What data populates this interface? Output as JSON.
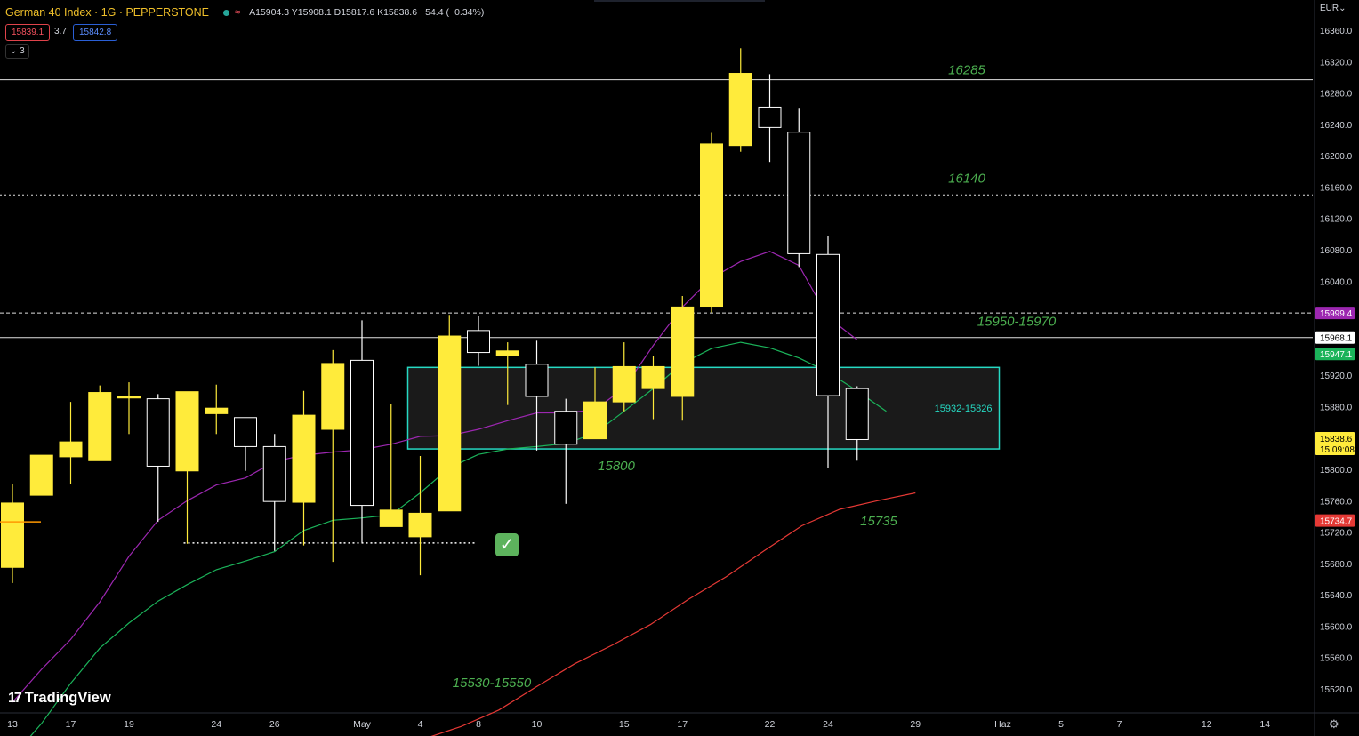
{
  "header": {
    "symbol": "German 40 Index · 1G · PEPPERSTONE",
    "ohlc": "A15904.3  Y15908.1  D15817.6  K15838.6  −54.4 (−0.34%)",
    "bid": "15839.1",
    "spread": "3.7",
    "ask": "15842.8",
    "indicators_toggle": "3"
  },
  "currency": "EUR",
  "branding": "TradingView",
  "icons": {
    "status_dot": "market-status-icon",
    "wave": "data-wave-icon",
    "checkmark": "checkmark-icon",
    "settings": "gear-icon",
    "logo": "tradingview-logo-icon"
  },
  "colors": {
    "bull_candle": "#ffeb3b",
    "bear_candle": "#000000",
    "ma_fast": "#9c27b0",
    "ma_mid": "#1bb35a",
    "ma_slow": "#e53935",
    "zone_border": "#26d9c3",
    "annotation": "#4caf50"
  },
  "chart_data": {
    "type": "candlestick",
    "ylim": [
      15495,
      16380
    ],
    "y_ticks": [
      "16360.0",
      "16320.0",
      "16280.0",
      "16240.0",
      "16200.0",
      "16160.0",
      "16120.0",
      "16080.0",
      "16040.0",
      "15920.0",
      "15880.0",
      "15800.0",
      "15760.0",
      "15720.0",
      "15680.0",
      "15640.0",
      "15600.0",
      "15560.0",
      "15520.0"
    ],
    "x_labels": [
      {
        "slot": 0,
        "label": "13"
      },
      {
        "slot": 2,
        "label": "17"
      },
      {
        "slot": 4,
        "label": "19"
      },
      {
        "slot": 7,
        "label": "24"
      },
      {
        "slot": 9,
        "label": "26"
      },
      {
        "slot": 12,
        "label": "May"
      },
      {
        "slot": 14,
        "label": "4"
      },
      {
        "slot": 16,
        "label": "8"
      },
      {
        "slot": 18,
        "label": "10"
      },
      {
        "slot": 21,
        "label": "15"
      },
      {
        "slot": 23,
        "label": "17"
      },
      {
        "slot": 26,
        "label": "22"
      },
      {
        "slot": 28,
        "label": "24"
      },
      {
        "slot": 31,
        "label": "29"
      },
      {
        "slot": 34,
        "label": "Haz"
      },
      {
        "slot": 36,
        "label": "5"
      },
      {
        "slot": 38,
        "label": "7"
      },
      {
        "slot": 41,
        "label": "12"
      },
      {
        "slot": 43,
        "label": "14"
      }
    ],
    "candles": [
      {
        "o": 15675,
        "h": 15781,
        "l": 15655,
        "c": 15757
      },
      {
        "o": 15767,
        "h": 15818,
        "l": 15767,
        "c": 15818
      },
      {
        "o": 15816,
        "h": 15886,
        "l": 15781,
        "c": 15835
      },
      {
        "o": 15811,
        "h": 15907,
        "l": 15811,
        "c": 15898
      },
      {
        "o": 15891,
        "h": 15911,
        "l": 15845,
        "c": 15893
      },
      {
        "o": 15890,
        "h": 15896,
        "l": 15733,
        "c": 15804
      },
      {
        "o": 15798,
        "h": 15898,
        "l": 15705,
        "c": 15899
      },
      {
        "o": 15871,
        "h": 15908,
        "l": 15845,
        "c": 15878
      },
      {
        "o": 15866,
        "h": 15864,
        "l": 15798,
        "c": 15829
      },
      {
        "o": 15829,
        "h": 15845,
        "l": 15696,
        "c": 15759
      },
      {
        "o": 15758,
        "h": 15900,
        "l": 15703,
        "c": 15869
      },
      {
        "o": 15851,
        "h": 15952,
        "l": 15682,
        "c": 15935
      },
      {
        "o": 15939,
        "h": 15990,
        "l": 15706,
        "c": 15754
      },
      {
        "o": 15727,
        "h": 15883,
        "l": 15728,
        "c": 15748
      },
      {
        "o": 15714,
        "h": 15817,
        "l": 15665,
        "c": 15744
      },
      {
        "o": 15747,
        "h": 15997,
        "l": 15749,
        "c": 15970
      },
      {
        "o": 15977,
        "h": 15995,
        "l": 15932,
        "c": 15949
      },
      {
        "o": 15945,
        "h": 15962,
        "l": 15882,
        "c": 15951
      },
      {
        "o": 15934,
        "h": 15964,
        "l": 15824,
        "c": 15893
      },
      {
        "o": 15874,
        "h": 15890,
        "l": 15756,
        "c": 15832
      },
      {
        "o": 15839,
        "h": 15930,
        "l": 15840,
        "c": 15886
      },
      {
        "o": 15886,
        "h": 15962,
        "l": 15874,
        "c": 15931
      },
      {
        "o": 15903,
        "h": 15945,
        "l": 15864,
        "c": 15931
      },
      {
        "o": 15893,
        "h": 16021,
        "l": 15862,
        "c": 16007
      },
      {
        "o": 16008,
        "h": 16229,
        "l": 16000,
        "c": 16215
      },
      {
        "o": 16213,
        "h": 16337,
        "l": 16205,
        "c": 16305
      },
      {
        "o": 16262,
        "h": 16304,
        "l": 16192,
        "c": 16236
      },
      {
        "o": 16230,
        "h": 16260,
        "l": 16058,
        "c": 16075
      },
      {
        "o": 16074,
        "h": 16097,
        "l": 15802,
        "c": 15894
      },
      {
        "o": 15903,
        "h": 15906,
        "l": 15811,
        "c": 15838
      }
    ],
    "ma_fast": [
      [
        0,
        15503
      ],
      [
        1,
        15545
      ],
      [
        2,
        15583
      ],
      [
        3,
        15631
      ],
      [
        4,
        15689
      ],
      [
        5,
        15735
      ],
      [
        6,
        15760
      ],
      [
        7,
        15780
      ],
      [
        8,
        15789
      ],
      [
        9,
        15810
      ],
      [
        10,
        15818
      ],
      [
        11,
        15822
      ],
      [
        12,
        15825
      ],
      [
        13,
        15832
      ],
      [
        14,
        15842
      ],
      [
        15,
        15843
      ],
      [
        16,
        15851
      ],
      [
        17,
        15862
      ],
      [
        18,
        15872
      ],
      [
        19,
        15872
      ],
      [
        20,
        15876
      ],
      [
        21,
        15904
      ],
      [
        22,
        15958
      ],
      [
        23,
        16007
      ],
      [
        24,
        16044
      ],
      [
        25,
        16065
      ],
      [
        26,
        16078
      ],
      [
        27,
        16060
      ],
      [
        28,
        15994
      ],
      [
        29,
        15965
      ]
    ],
    "ma_mid": [
      [
        0,
        15433
      ],
      [
        1,
        15476
      ],
      [
        2,
        15527
      ],
      [
        3,
        15572
      ],
      [
        4,
        15604
      ],
      [
        5,
        15632
      ],
      [
        6,
        15653
      ],
      [
        7,
        15672
      ],
      [
        8,
        15683
      ],
      [
        9,
        15695
      ],
      [
        10,
        15722
      ],
      [
        11,
        15735
      ],
      [
        12,
        15738
      ],
      [
        13,
        15742
      ],
      [
        14,
        15770
      ],
      [
        15,
        15802
      ],
      [
        16,
        15819
      ],
      [
        17,
        15826
      ],
      [
        18,
        15829
      ],
      [
        19,
        15833
      ],
      [
        20,
        15846
      ],
      [
        21,
        15874
      ],
      [
        22,
        15903
      ],
      [
        23,
        15935
      ],
      [
        24,
        15954
      ],
      [
        25,
        15962
      ],
      [
        26,
        15955
      ],
      [
        27,
        15942
      ],
      [
        28,
        15924
      ],
      [
        29,
        15900
      ],
      [
        30,
        15874
      ]
    ],
    "ma_slow": [
      [
        0,
        15419
      ],
      [
        1,
        15435
      ],
      [
        2,
        15456
      ],
      [
        3,
        15472
      ],
      [
        4,
        15493
      ],
      [
        5,
        15523
      ],
      [
        6,
        15552
      ],
      [
        7,
        15576
      ],
      [
        8,
        15602
      ],
      [
        9,
        15634
      ],
      [
        10,
        15663
      ],
      [
        11,
        15696
      ],
      [
        12,
        15728
      ],
      [
        13,
        15749
      ],
      [
        14,
        15760
      ],
      [
        15,
        15770
      ]
    ],
    "hlines": [
      {
        "price": 16297,
        "style": "solid",
        "label": "16285"
      },
      {
        "price": 16150,
        "style": "dotted",
        "label": "16140"
      },
      {
        "price": 15999.4,
        "style": "dashed",
        "label": "15950-15970"
      },
      {
        "price": 15968.1,
        "style": "solid"
      }
    ],
    "zone": {
      "from_slot": 14,
      "to_slot": 34,
      "top": 15930,
      "bottom": 15826,
      "label": "15932-15826"
    },
    "dotted_low": {
      "from_slot": 6,
      "to_slot": 16,
      "price": 15706
    },
    "annotations": [
      "15800",
      "15735",
      "15530-15550"
    ],
    "price_tags": [
      {
        "price": 15999.4,
        "text": "15999.4",
        "bg": "#9c27b0",
        "fg": "#ffffff"
      },
      {
        "price": 15968.1,
        "text": "15968.1",
        "bg": "#ffffff",
        "fg": "#000000"
      },
      {
        "price": 15947.1,
        "text": "15947.1",
        "bg": "#1bb35a",
        "fg": "#ffffff"
      },
      {
        "price": 15838.6,
        "text": "15838.6",
        "countdown": "15:09:08",
        "bg": "#ffeb3b",
        "fg": "#000000"
      },
      {
        "price": 15734.7,
        "text": "15734.7",
        "bg": "#e53935",
        "fg": "#ffffff"
      }
    ]
  }
}
